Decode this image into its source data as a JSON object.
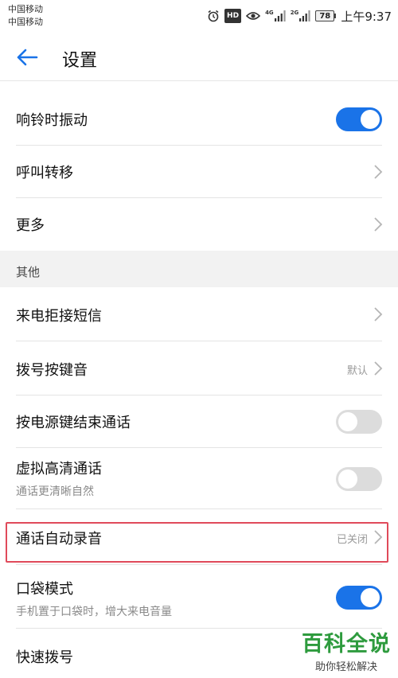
{
  "status_bar": {
    "carrier_1": "中国移动",
    "carrier_2": "中国移动",
    "hd_label": "HD",
    "net_1": "4G",
    "net_2": "2G",
    "battery": "78",
    "time": "上午9:37",
    "icons": [
      "alarm-icon",
      "hd-icon",
      "eye-icon",
      "signal-icon",
      "battery-icon"
    ]
  },
  "app_bar": {
    "title": "设置",
    "back_icon": "arrow-left-icon",
    "accent_color": "#1a73e8"
  },
  "items": {
    "ring_vibrate": {
      "label": "响铃时振动",
      "toggle_on": true
    },
    "call_forward": {
      "label": "呼叫转移"
    },
    "more": {
      "label": "更多"
    },
    "section_other": {
      "label": "其他"
    },
    "reject_sms": {
      "label": "来电拒接短信"
    },
    "dial_tone": {
      "label": "拨号按键音",
      "value": "默认"
    },
    "power_end_call": {
      "label": "按电源键结束通话",
      "toggle_on": false
    },
    "virtual_hd": {
      "label": "虚拟高清通话",
      "sub": "通话更清晰自然",
      "toggle_on": false
    },
    "auto_record": {
      "label": "通话自动录音",
      "value": "已关闭"
    },
    "pocket_mode": {
      "label": "口袋模式",
      "sub": "手机置于口袋时，增大来电音量",
      "toggle_on": true
    },
    "speed_dial": {
      "label": "快速拨号"
    }
  },
  "watermark": {
    "title": "百科全说",
    "subtitle": "助你轻松解决",
    "color": "#2e9b3e"
  },
  "highlight_color": "#e04a5a"
}
